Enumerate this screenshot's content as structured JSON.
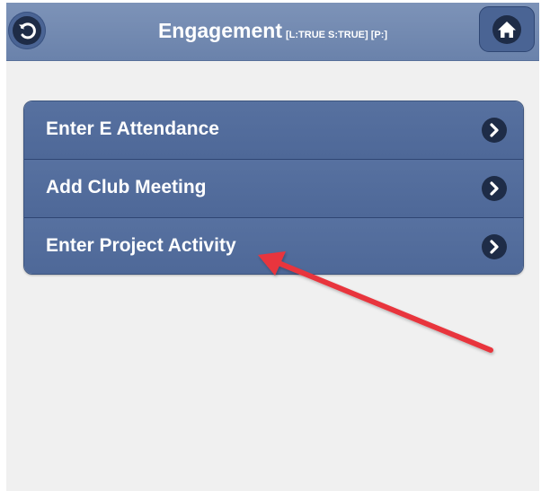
{
  "header": {
    "title": "Engagement",
    "status": "[L:TRUE S:TRUE] [P:]",
    "back_icon": "back-arrow-icon",
    "home_icon": "home-icon"
  },
  "menu": {
    "items": [
      {
        "label": "Enter E Attendance",
        "icon": "chevron-right-icon"
      },
      {
        "label": "Add Club Meeting",
        "icon": "chevron-right-icon"
      },
      {
        "label": "Enter Project Activity",
        "icon": "chevron-right-icon"
      }
    ]
  },
  "colors": {
    "header_bg": "#7188b0",
    "menu_bg": "#5470a0",
    "icon_bg": "#1e2c47",
    "page_bg": "#f0f0f0",
    "annotation_arrow": "#e8353c"
  }
}
